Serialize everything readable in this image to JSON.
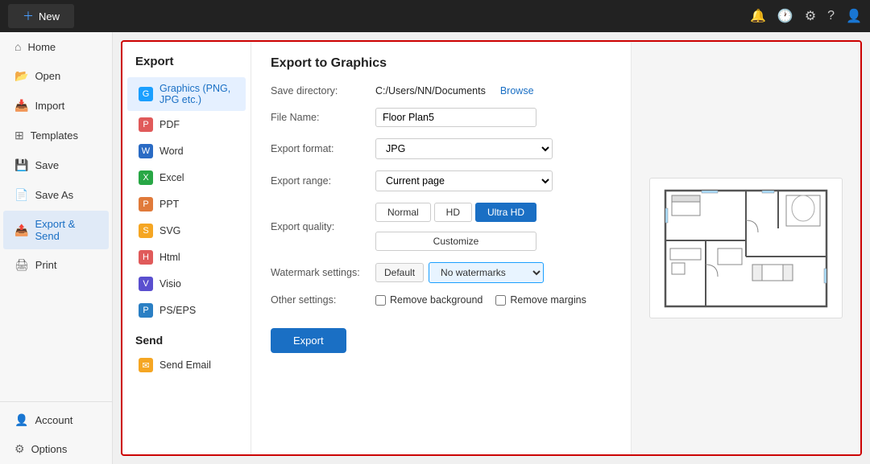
{
  "topbar": {
    "new_label": "New",
    "new_icon": "＋",
    "icons": [
      "🔔",
      "🕐",
      "⚙",
      "?",
      "👤"
    ]
  },
  "sidebar": {
    "items": [
      {
        "id": "home",
        "label": "Home",
        "icon": "⌂"
      },
      {
        "id": "open",
        "label": "Open",
        "icon": "📂"
      },
      {
        "id": "import",
        "label": "Import",
        "icon": "📥"
      },
      {
        "id": "templates",
        "label": "Templates",
        "icon": "⊞"
      },
      {
        "id": "save",
        "label": "Save",
        "icon": "💾"
      },
      {
        "id": "save-as",
        "label": "Save As",
        "icon": "📄"
      },
      {
        "id": "export-send",
        "label": "Export & Send",
        "icon": "📤",
        "active": true
      },
      {
        "id": "print",
        "label": "Print",
        "icon": "🖨"
      }
    ],
    "bottom_items": [
      {
        "id": "account",
        "label": "Account",
        "icon": "👤"
      },
      {
        "id": "options",
        "label": "Options",
        "icon": "⚙"
      }
    ]
  },
  "export_nav": {
    "title": "Export",
    "items": [
      {
        "id": "graphics",
        "label": "Graphics (PNG, JPG etc.)",
        "icon": "G",
        "color": "icon-graphics",
        "active": true
      },
      {
        "id": "pdf",
        "label": "PDF",
        "icon": "P",
        "color": "icon-pdf"
      },
      {
        "id": "word",
        "label": "Word",
        "icon": "W",
        "color": "icon-word"
      },
      {
        "id": "excel",
        "label": "Excel",
        "icon": "X",
        "color": "icon-excel"
      },
      {
        "id": "ppt",
        "label": "PPT",
        "icon": "P",
        "color": "icon-ppt"
      },
      {
        "id": "svg",
        "label": "SVG",
        "icon": "S",
        "color": "icon-svg"
      },
      {
        "id": "html",
        "label": "Html",
        "icon": "H",
        "color": "icon-html"
      },
      {
        "id": "visio",
        "label": "Visio",
        "icon": "V",
        "color": "icon-visio"
      },
      {
        "id": "pseps",
        "label": "PS/EPS",
        "icon": "P",
        "color": "icon-pseps"
      }
    ],
    "send_section": "Send",
    "send_items": [
      {
        "id": "send-email",
        "label": "Send Email",
        "icon": "✉",
        "color": "icon-send"
      }
    ]
  },
  "export_to_graphics": {
    "title": "Export to Graphics",
    "fields": {
      "save_directory_label": "Save directory:",
      "save_directory_value": "C:/Users/NN/Documents",
      "browse_label": "Browse",
      "file_name_label": "File Name:",
      "file_name_value": "Floor Plan5",
      "export_format_label": "Export format:",
      "export_format_value": "JPG",
      "export_range_label": "Export range:",
      "export_range_value": "Current page",
      "export_quality_label": "Export quality:",
      "quality_normal": "Normal",
      "quality_hd": "HD",
      "quality_ultrahd": "Ultra HD",
      "customize_label": "Customize",
      "watermark_label": "Watermark settings:",
      "watermark_default": "Default",
      "watermark_select": "No watermarks",
      "other_settings_label": "Other settings:",
      "remove_bg_label": "Remove background",
      "remove_margins_label": "Remove margins",
      "export_btn": "Export"
    }
  }
}
